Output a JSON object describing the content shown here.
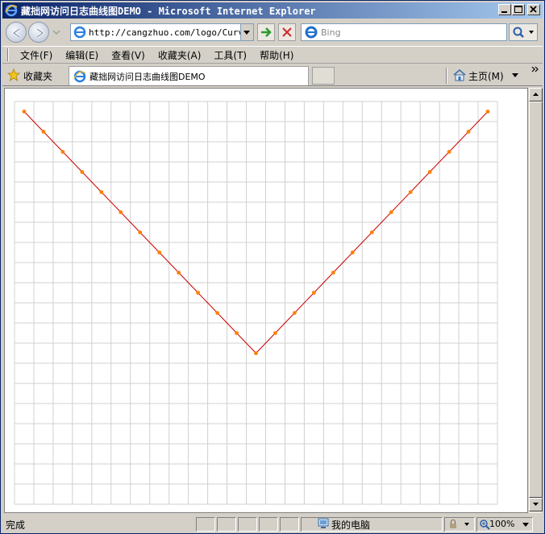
{
  "window": {
    "title": "藏拙网访问日志曲线图DEMO - Microsoft Internet Explorer"
  },
  "address": {
    "url": "http://cangzhuo.com/logo/Curve.",
    "search_placeholder": "Bing"
  },
  "menu": {
    "items": [
      "文件(F)",
      "编辑(E)",
      "查看(V)",
      "收藏夹(A)",
      "工具(T)",
      "帮助(H)"
    ]
  },
  "favorites": {
    "label": "收藏夹",
    "tab_label": "藏拙网访问日志曲线图DEMO",
    "home_label": "主页(M)"
  },
  "status": {
    "text": "完成",
    "zone": "我的电脑",
    "zoom": "100%"
  },
  "colors": {
    "line": "#cc0000",
    "marker": "#ff7f00",
    "grid": "#d0d0d0"
  },
  "chart_data": {
    "type": "line",
    "x": [
      0,
      1,
      2,
      3,
      4,
      5,
      6,
      7,
      8,
      9,
      10,
      11,
      12,
      13,
      14,
      15,
      16,
      17,
      18,
      19,
      20,
      21,
      22,
      23,
      24
    ],
    "values": [
      12,
      11,
      10,
      9,
      8,
      7,
      6,
      5,
      4,
      3,
      2,
      1,
      0,
      1,
      2,
      3,
      4,
      5,
      6,
      7,
      8,
      9,
      10,
      11,
      12
    ],
    "xlim": [
      -0.5,
      24.5
    ],
    "ylim": [
      -7.5,
      12.5
    ],
    "grid": true
  }
}
